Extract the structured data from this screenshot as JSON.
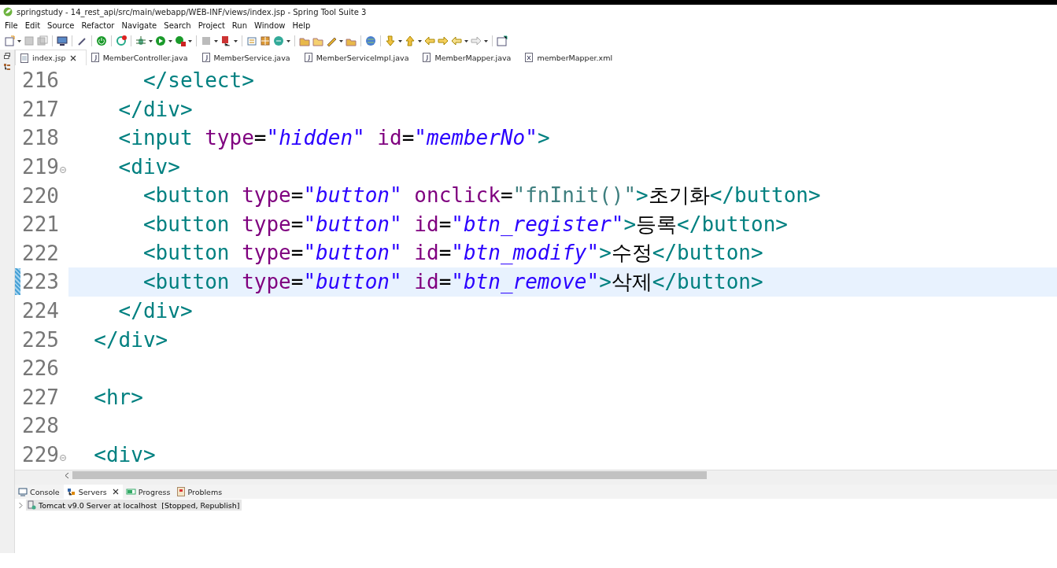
{
  "window": {
    "title": "springstudy - 14_rest_api/src/main/webapp/WEB-INF/views/index.jsp - Spring Tool Suite 3"
  },
  "menu": [
    "File",
    "Edit",
    "Source",
    "Refactor",
    "Navigate",
    "Search",
    "Project",
    "Run",
    "Window",
    "Help"
  ],
  "editor_tabs": [
    {
      "label": "index.jsp",
      "kind": "jsp",
      "selected": true,
      "closable": true
    },
    {
      "label": "MemberController.java",
      "kind": "java",
      "selected": false,
      "closable": false
    },
    {
      "label": "MemberService.java",
      "kind": "java",
      "selected": false,
      "closable": false
    },
    {
      "label": "MemberServiceImpl.java",
      "kind": "java",
      "selected": false,
      "closable": false
    },
    {
      "label": "MemberMapper.java",
      "kind": "java",
      "selected": false,
      "closable": false
    },
    {
      "label": "memberMapper.xml",
      "kind": "xml",
      "selected": false,
      "closable": false
    }
  ],
  "code_lines": [
    {
      "number": "216",
      "folding": false,
      "current": false,
      "tokens": [
        {
          "kind": "tag",
          "text": "      </select>"
        }
      ]
    },
    {
      "number": "217",
      "folding": false,
      "current": false,
      "tokens": [
        {
          "kind": "tag",
          "text": "    </div>"
        }
      ]
    },
    {
      "number": "218",
      "folding": false,
      "current": false,
      "tokens": [
        {
          "kind": "tag",
          "text": "    <input"
        },
        {
          "kind": "attr",
          "text": " type"
        },
        {
          "kind": "eq",
          "text": "="
        },
        {
          "kind": "str",
          "text": "\"hidden\""
        },
        {
          "kind": "attr",
          "text": " id"
        },
        {
          "kind": "eq",
          "text": "="
        },
        {
          "kind": "str",
          "text": "\"memberNo\""
        },
        {
          "kind": "tag",
          "text": ">"
        }
      ]
    },
    {
      "number": "219",
      "folding": true,
      "current": false,
      "tokens": [
        {
          "kind": "tag",
          "text": "    <div>"
        }
      ]
    },
    {
      "number": "220",
      "folding": false,
      "current": false,
      "tokens": [
        {
          "kind": "tag",
          "text": "      <button"
        },
        {
          "kind": "attr",
          "text": " type"
        },
        {
          "kind": "eq",
          "text": "="
        },
        {
          "kind": "str",
          "text": "\"button\""
        },
        {
          "kind": "attr",
          "text": " onclick"
        },
        {
          "kind": "eq",
          "text": "="
        },
        {
          "kind": "script",
          "text": "\"fnInit()\""
        },
        {
          "kind": "tag",
          "text": ">"
        },
        {
          "kind": "text",
          "text": "초기화"
        },
        {
          "kind": "tag",
          "text": "</button>"
        }
      ]
    },
    {
      "number": "221",
      "folding": false,
      "current": false,
      "tokens": [
        {
          "kind": "tag",
          "text": "      <button"
        },
        {
          "kind": "attr",
          "text": " type"
        },
        {
          "kind": "eq",
          "text": "="
        },
        {
          "kind": "str",
          "text": "\"button\""
        },
        {
          "kind": "attr",
          "text": " id"
        },
        {
          "kind": "eq",
          "text": "="
        },
        {
          "kind": "str",
          "text": "\"btn_register\""
        },
        {
          "kind": "tag",
          "text": ">"
        },
        {
          "kind": "text",
          "text": "등록"
        },
        {
          "kind": "tag",
          "text": "</button>"
        }
      ]
    },
    {
      "number": "222",
      "folding": false,
      "current": false,
      "tokens": [
        {
          "kind": "tag",
          "text": "      <button"
        },
        {
          "kind": "attr",
          "text": " type"
        },
        {
          "kind": "eq",
          "text": "="
        },
        {
          "kind": "str",
          "text": "\"button\""
        },
        {
          "kind": "attr",
          "text": " id"
        },
        {
          "kind": "eq",
          "text": "="
        },
        {
          "kind": "str",
          "text": "\"btn_modify\""
        },
        {
          "kind": "tag",
          "text": ">"
        },
        {
          "kind": "text",
          "text": "수정"
        },
        {
          "kind": "tag",
          "text": "</button>"
        }
      ]
    },
    {
      "number": "223",
      "folding": false,
      "current": true,
      "tokens": [
        {
          "kind": "tag",
          "text": "      <button"
        },
        {
          "kind": "attr",
          "text": " type"
        },
        {
          "kind": "eq",
          "text": "="
        },
        {
          "kind": "str",
          "text": "\"button\""
        },
        {
          "kind": "attr",
          "text": " id"
        },
        {
          "kind": "eq",
          "text": "="
        },
        {
          "kind": "str",
          "text": "\"btn_remove\""
        },
        {
          "kind": "tag",
          "text": ">"
        },
        {
          "kind": "text",
          "text": "삭제"
        },
        {
          "kind": "tag",
          "text": "</button>"
        }
      ]
    },
    {
      "number": "224",
      "folding": false,
      "current": false,
      "tokens": [
        {
          "kind": "tag",
          "text": "    </div>"
        }
      ]
    },
    {
      "number": "225",
      "folding": false,
      "current": false,
      "tokens": [
        {
          "kind": "tag",
          "text": "  </div>"
        }
      ]
    },
    {
      "number": "226",
      "folding": false,
      "current": false
    },
    {
      "number": "227",
      "folding": false,
      "current": false,
      "tokens": [
        {
          "kind": "tag",
          "text": "  <hr>"
        }
      ]
    },
    {
      "number": "228",
      "folding": false,
      "current": false
    },
    {
      "number": "229",
      "folding": true,
      "current": false,
      "tokens": [
        {
          "kind": "tag",
          "text": "  <div>"
        }
      ]
    }
  ],
  "bottom_panel": {
    "tabs": [
      {
        "label": "Console",
        "kind": "console",
        "selected": false,
        "closable": false
      },
      {
        "label": "Servers",
        "kind": "servers",
        "selected": true,
        "closable": true
      },
      {
        "label": "Progress",
        "kind": "progress",
        "selected": false,
        "closable": false
      },
      {
        "label": "Problems",
        "kind": "problems",
        "selected": false,
        "closable": false
      }
    ],
    "servers": [
      {
        "name": "Tomcat v9.0 Server at localhost",
        "status": "[Stopped, Republish]",
        "expanded": false
      }
    ]
  }
}
